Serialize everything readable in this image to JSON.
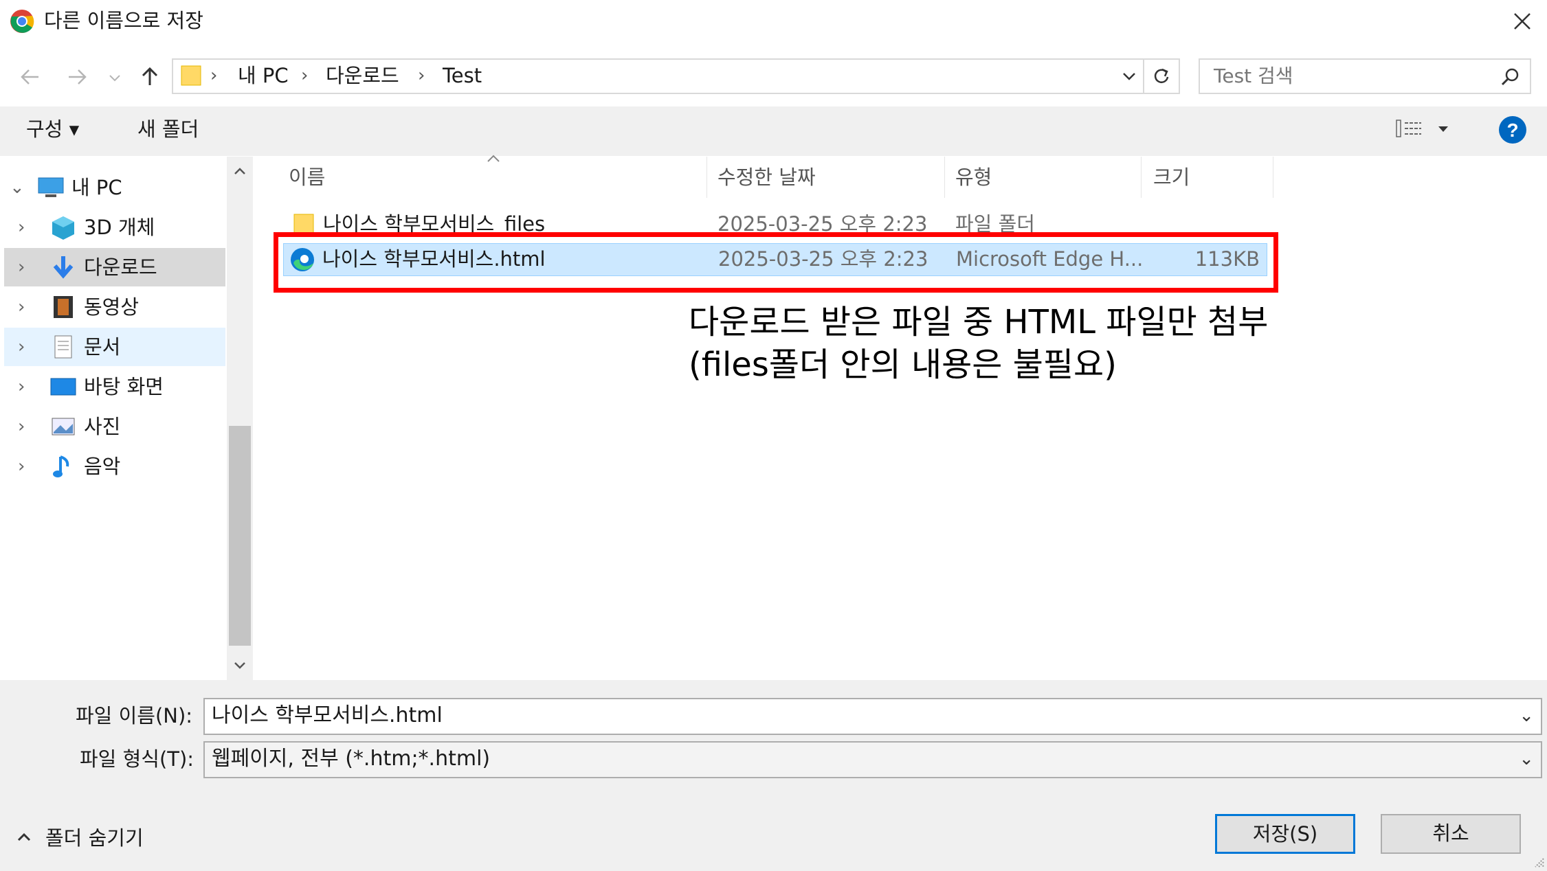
{
  "window": {
    "title": "다른 이름으로 저장"
  },
  "address": {
    "crumbs": [
      "내 PC",
      "다운로드",
      "Test"
    ],
    "search_placeholder": "Test 검색"
  },
  "toolbar": {
    "organize_label": "구성 ▾",
    "new_folder_label": "새 폴더"
  },
  "nav": {
    "items": [
      {
        "label": "내 PC",
        "icon": "pc-icon",
        "expanded": true
      },
      {
        "label": "3D 개체",
        "icon": "cube-icon"
      },
      {
        "label": "다운로드",
        "icon": "download-icon",
        "selected": true
      },
      {
        "label": "동영상",
        "icon": "video-icon"
      },
      {
        "label": "문서",
        "icon": "document-icon",
        "hover": true
      },
      {
        "label": "바탕 화면",
        "icon": "desktop-icon"
      },
      {
        "label": "사진",
        "icon": "pictures-icon"
      },
      {
        "label": "음악",
        "icon": "music-icon"
      }
    ]
  },
  "columns": [
    "이름",
    "수정한 날짜",
    "유형",
    "크기"
  ],
  "files": [
    {
      "name": "나이스 학부모서비스_files",
      "date": "2025-03-25 오후 2:23",
      "type": "파일 폴더",
      "size": ""
    },
    {
      "name": "나이스 학부모서비스.html",
      "date": "2025-03-25 오후 2:23",
      "type": "Microsoft Edge H...",
      "size": "113KB",
      "selected": true
    }
  ],
  "annotation": {
    "line1": "다운로드 받은 파일 중 HTML 파일만 첨부",
    "line2": "(files폴더 안의 내용은 불필요)",
    "color": "#ff0000"
  },
  "bottom": {
    "filename_label": "파일 이름(N):",
    "filename_value": "나이스 학부모서비스.html",
    "filetype_label": "파일 형식(T):",
    "filetype_value": "웹페이지, 전부 (*.htm;*.html)",
    "hide_folders_label": "폴더 숨기기",
    "save_label": "저장(S)",
    "cancel_label": "취소"
  },
  "colors": {
    "accent": "#0078d7",
    "selection": "#cce8ff",
    "help": "#0067c0"
  }
}
